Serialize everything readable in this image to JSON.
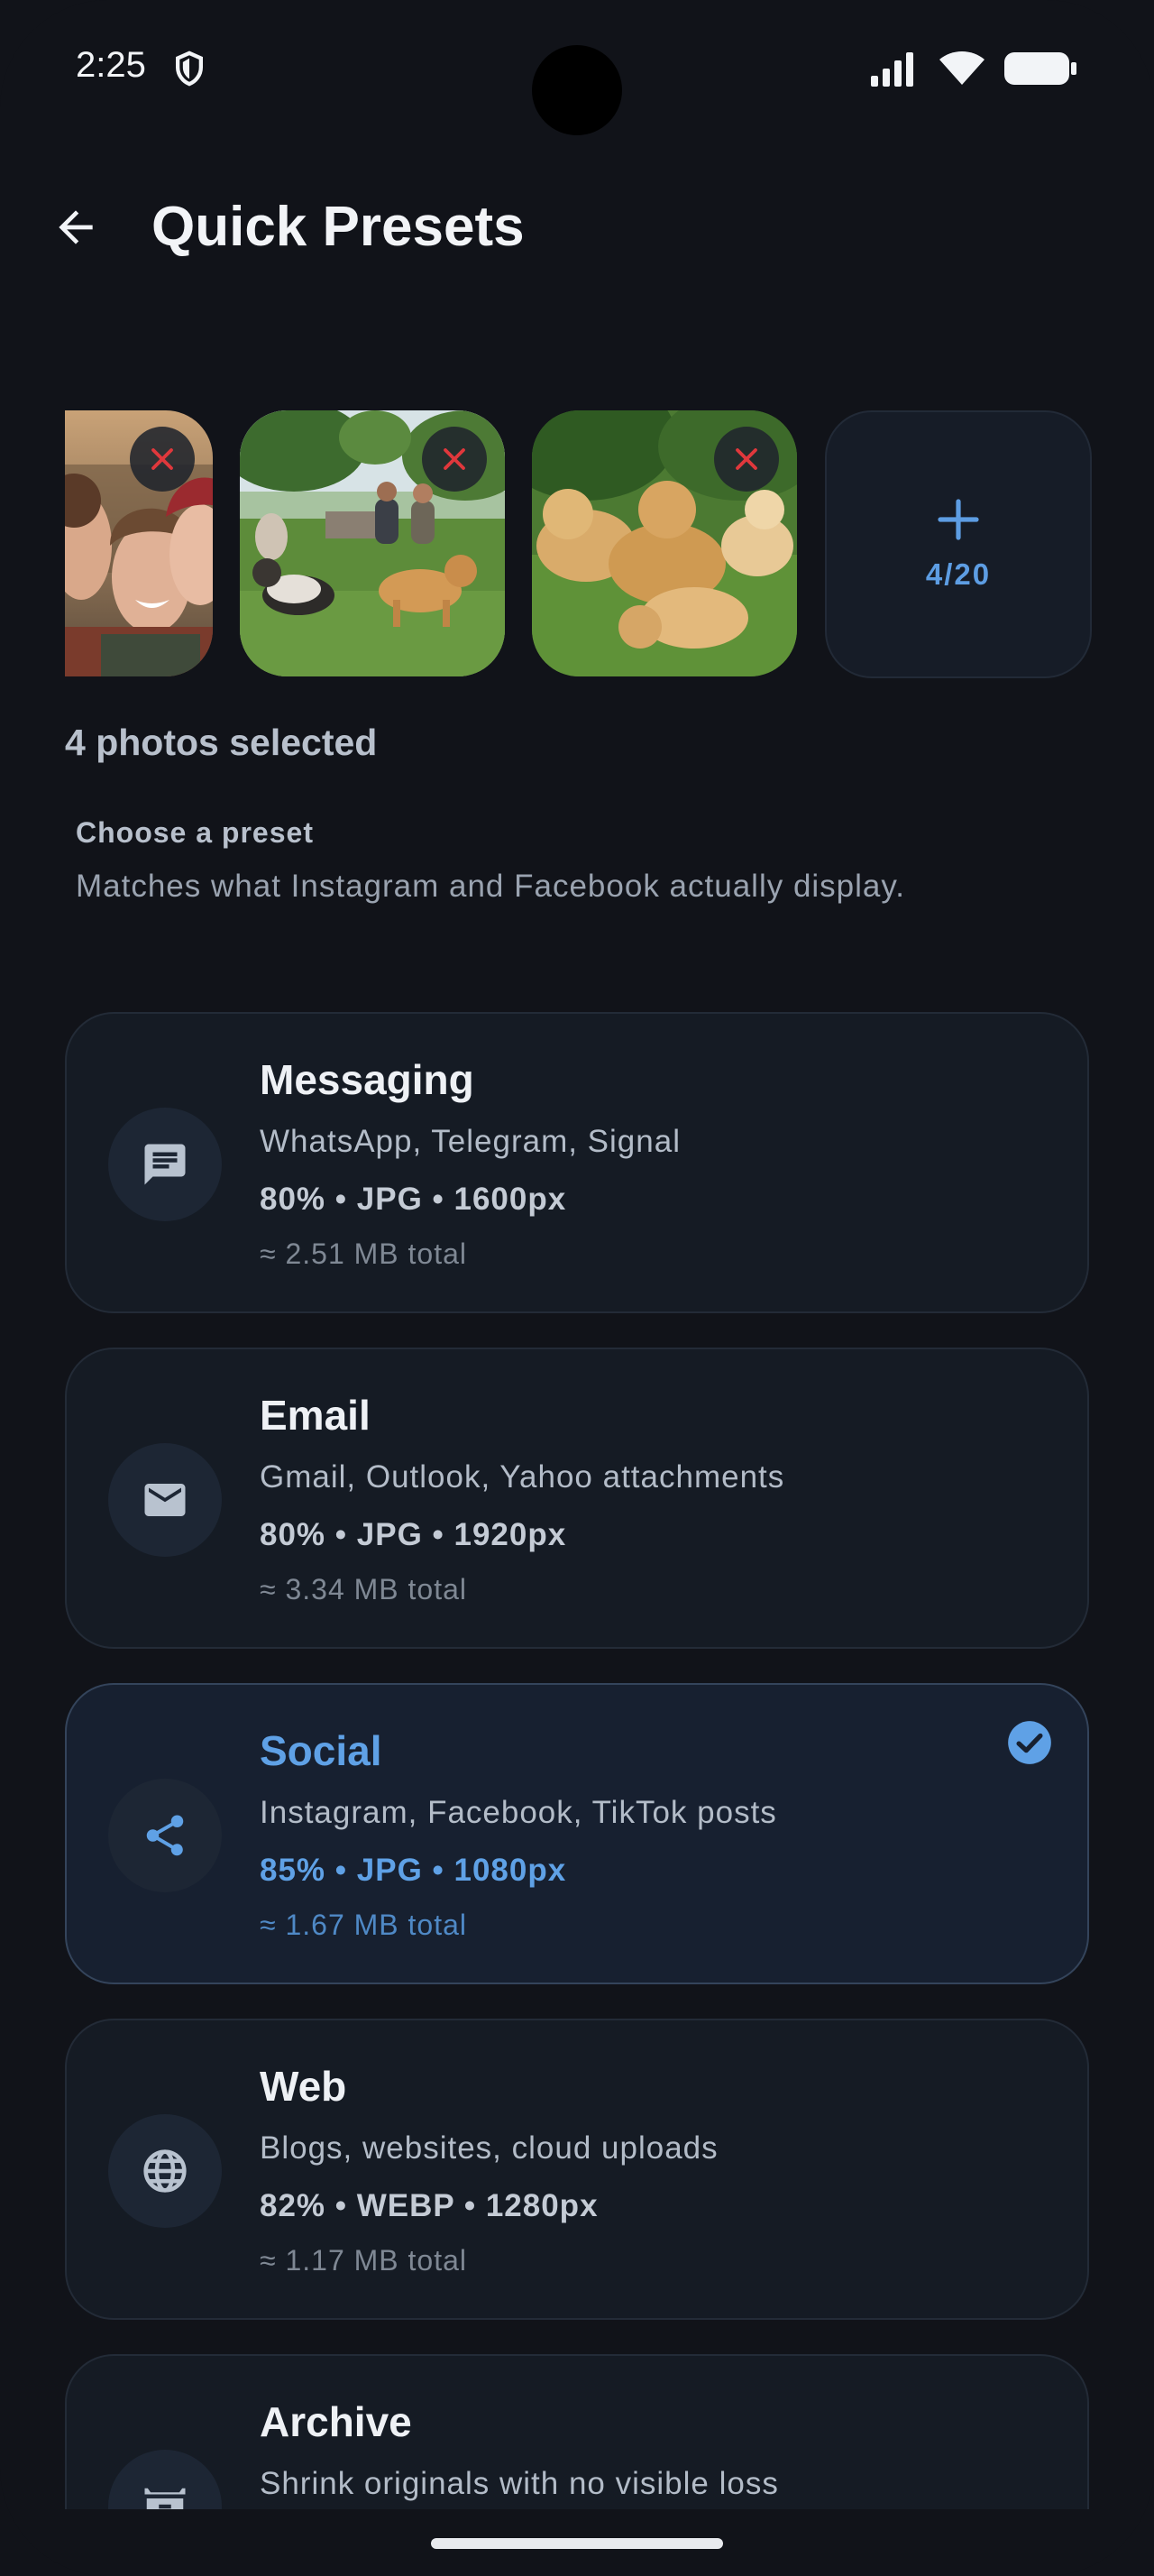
{
  "status_bar": {
    "time": "2:25",
    "icons": [
      "shield-icon",
      "signal-icon",
      "wifi-icon",
      "battery-icon"
    ]
  },
  "app_bar": {
    "title": "Quick Presets",
    "back_icon": "arrow-back-icon"
  },
  "photos": {
    "thumbnails": [
      {
        "name": "selfie-photo"
      },
      {
        "name": "park-dogs-photo"
      },
      {
        "name": "puppies-photo"
      }
    ],
    "remove_icon": "close-icon",
    "add_tile": {
      "icon": "plus-icon",
      "count": "4/20"
    },
    "selected_text": "4 photos selected"
  },
  "section": {
    "title": "Choose a preset",
    "subtitle": "Matches what Instagram and Facebook actually display."
  },
  "presets": [
    {
      "title": "Messaging",
      "desc": "WhatsApp, Telegram, Signal",
      "spec": "80% • JPG • 1600px",
      "size": "≈ 2.51 MB total",
      "icon": "message-icon",
      "selected": false
    },
    {
      "title": "Email",
      "desc": "Gmail, Outlook, Yahoo attachments",
      "spec": "80% • JPG • 1920px",
      "size": "≈ 3.34 MB total",
      "icon": "mail-icon",
      "selected": false
    },
    {
      "title": "Social",
      "desc": "Instagram, Facebook, TikTok posts",
      "spec": "85% • JPG • 1080px",
      "size": "≈ 1.67 MB total",
      "icon": "share-icon",
      "selected": true
    },
    {
      "title": "Web",
      "desc": "Blogs, websites, cloud uploads",
      "spec": "82% • WEBP • 1280px",
      "size": "≈ 1.17 MB total",
      "icon": "globe-icon",
      "selected": false
    },
    {
      "title": "Archive",
      "desc": "Shrink originals with no visible loss",
      "icon": "archive-icon",
      "selected": false
    }
  ],
  "colors": {
    "background": "#111319",
    "card": "#151b24",
    "accent": "#5fa1e6",
    "remove": "#e0383c"
  }
}
